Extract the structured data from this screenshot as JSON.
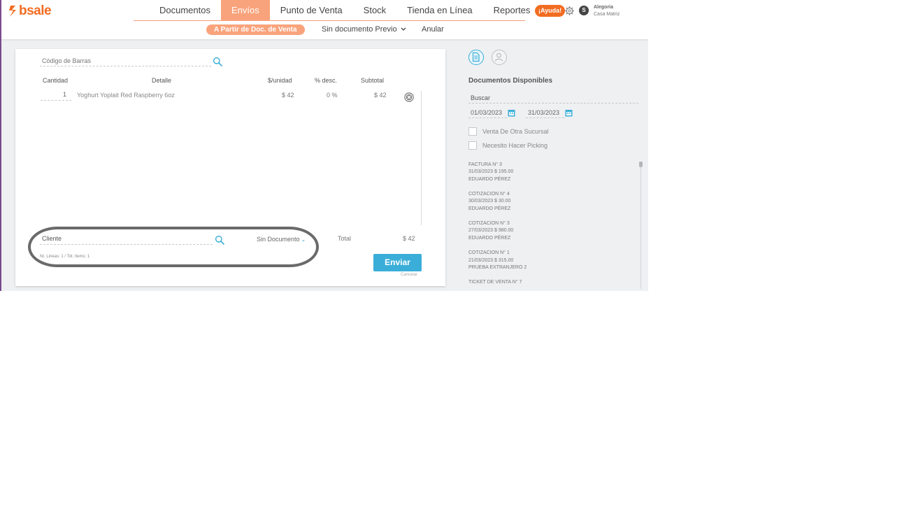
{
  "brand": {
    "name": "bsale",
    "color": "#f26c21"
  },
  "nav": {
    "items": [
      {
        "label": "Documentos",
        "active": false
      },
      {
        "label": "Envíos",
        "active": true
      },
      {
        "label": "Punto de Venta",
        "active": false
      },
      {
        "label": "Stock",
        "active": false
      },
      {
        "label": "Tienda en Línea",
        "active": false
      },
      {
        "label": "Reportes",
        "active": false
      }
    ],
    "help_label": "¡Ayuda!",
    "avatar_initial": "S",
    "company_name": "Alegoria",
    "branch_name": "Casa Matriz"
  },
  "subnav": {
    "from_doc_label": "A Partir de Doc. de Venta",
    "no_doc_label": "Sin documento Previo",
    "cancel_label": "Anular"
  },
  "form": {
    "barcode_placeholder": "Código de Barras",
    "columns": {
      "qty": "Cantidad",
      "detail": "Detalle",
      "unit_price": "$/unidad",
      "discount": "% desc.",
      "subtotal": "Subtotal"
    },
    "lines": [
      {
        "qty": "1",
        "detail": "Yoghurt Yoplait Red Raspberry 6oz",
        "unit_price": "$ 42",
        "discount": "0 %",
        "subtotal": "$ 42"
      }
    ],
    "client_placeholder": "Cliente",
    "doc_type": "Sin Documento",
    "total_label": "Total",
    "total_value": "$ 42",
    "lines_info": "Nr. Lineas: 1 / Tot. Items: 1",
    "send_label": "Enviar",
    "cancel_label": "Cancelar"
  },
  "sidebar": {
    "title": "Documentos Disponibles",
    "search_placeholder": "Buscar",
    "date_from": "01/03/2023",
    "date_to": "31/03/2023",
    "checkbox_other_branch": "Venta De Otra Sucursal",
    "checkbox_picking": "Necesito Hacer Picking",
    "documents": [
      {
        "title": "FACTURA N° 3",
        "date_amount": "31/03/2023 $ 195.00",
        "client": "EDUARDO PÉREZ"
      },
      {
        "title": "COTIZACION N° 4",
        "date_amount": "30/03/2023 $ 30.00",
        "client": "EDUARDO PÉREZ"
      },
      {
        "title": "COTIZACION N° 3",
        "date_amount": "27/03/2023 $ 980.00",
        "client": "EDUARDO PÉREZ"
      },
      {
        "title": "COTIZACION N° 1",
        "date_amount": "21/03/2023 $ 315.00",
        "client": "PRUEBA EXTRANJERO 2"
      },
      {
        "title": "TICKET DE VENTA N° 7",
        "date_amount": "",
        "client": ""
      }
    ]
  },
  "colors": {
    "accent": "#f26c21",
    "active_tab": "#f9a37c",
    "primary_button": "#3aaed8"
  }
}
